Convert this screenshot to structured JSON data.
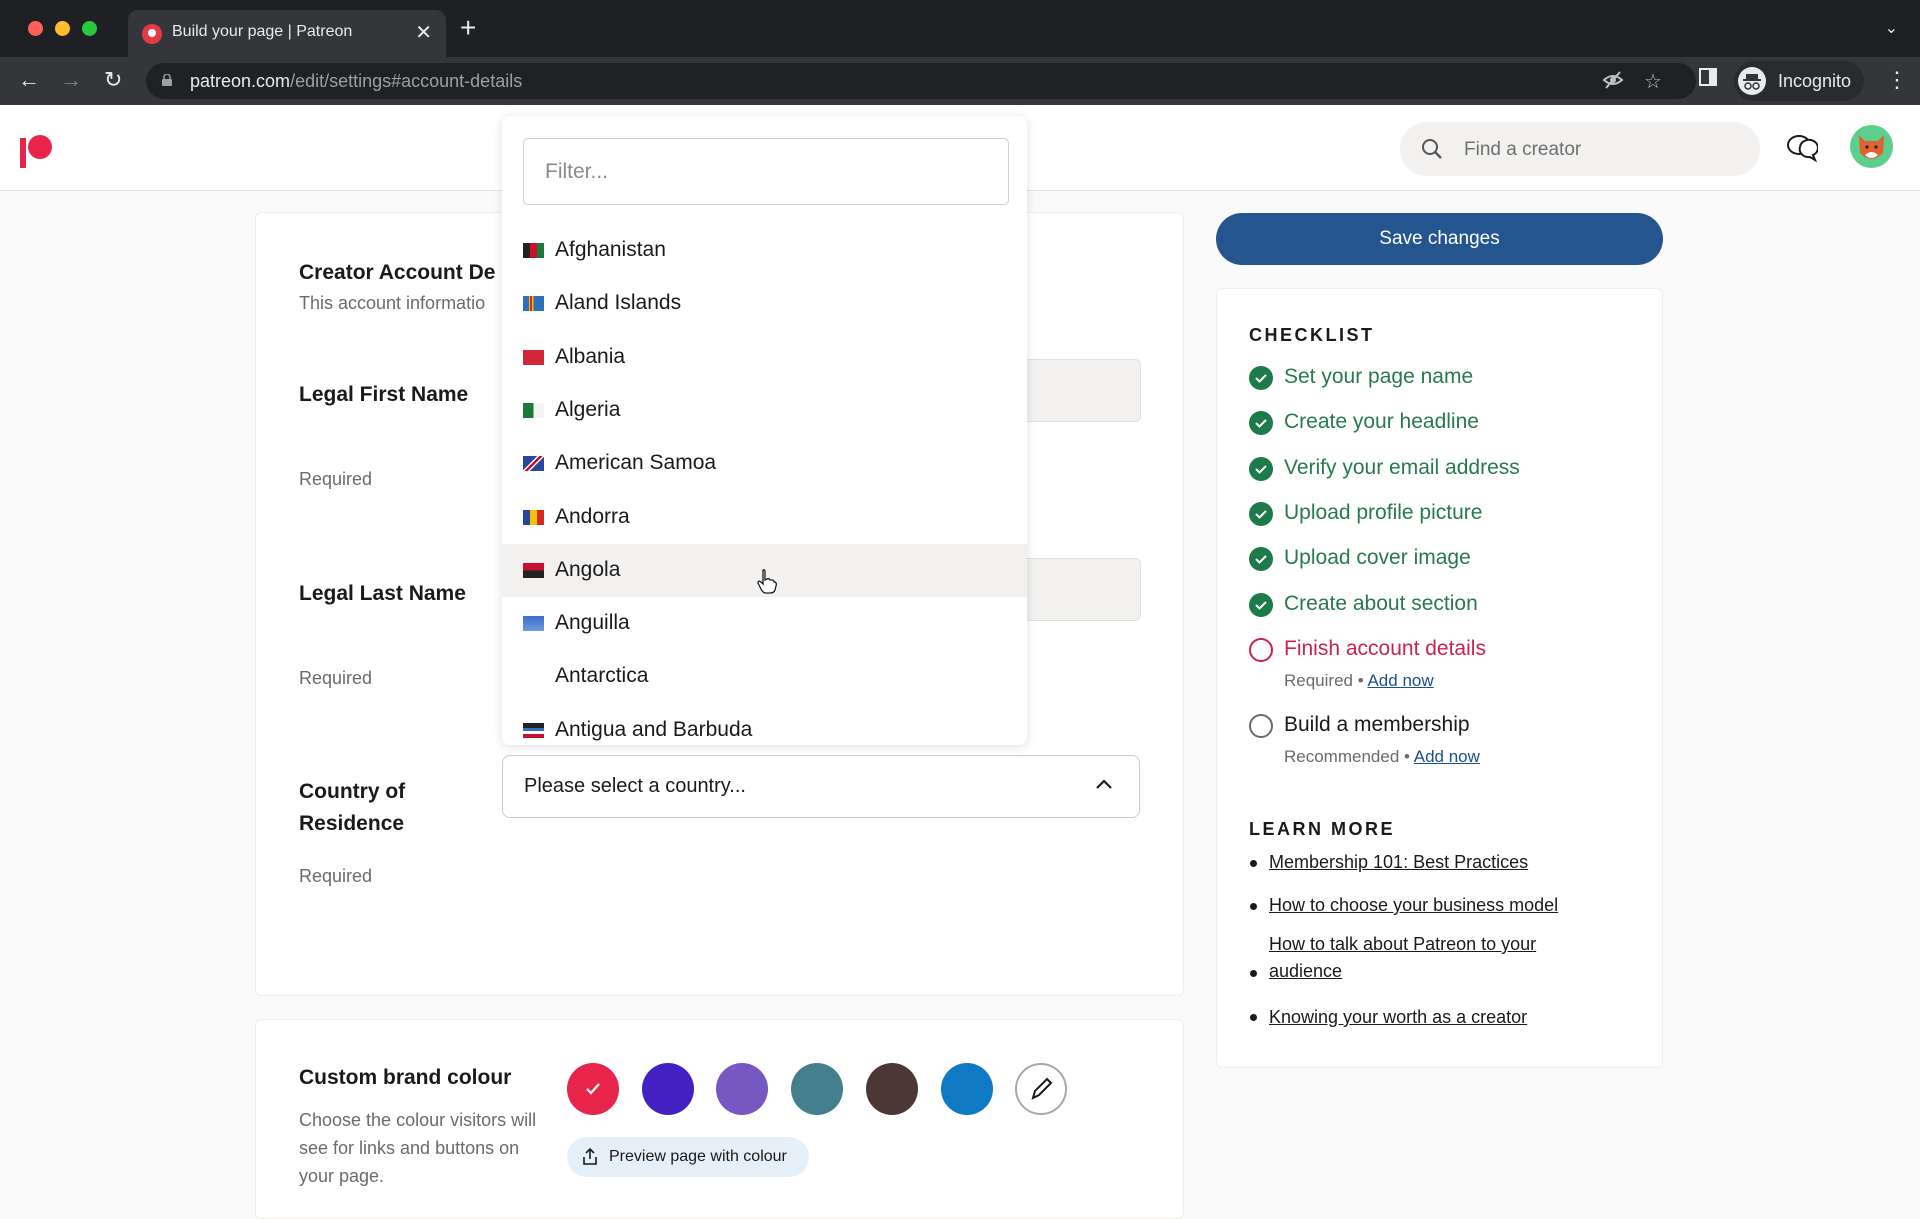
{
  "browser": {
    "tab_title": "Build your page | Patreon",
    "url_domain": "patreon.com",
    "url_path": "/edit/settings#account-details",
    "profile_label": "Incognito"
  },
  "header": {
    "search_placeholder": "Find a creator"
  },
  "account_details": {
    "title": "Creator Account De",
    "subtitle": "This account informatio",
    "fields": [
      {
        "label": "Legal First Name",
        "hint": "Required",
        "value": ""
      },
      {
        "label": "Legal Last Name",
        "hint": "Required",
        "value": ""
      },
      {
        "label": "Country of Residence",
        "hint": "Required",
        "value": "Please select a country..."
      }
    ]
  },
  "country_dropdown": {
    "filter_placeholder": "Filter...",
    "options": [
      {
        "name": "Afghanistan",
        "flag": "af"
      },
      {
        "name": "Aland Islands",
        "flag": "ax"
      },
      {
        "name": "Albania",
        "flag": "al"
      },
      {
        "name": "Algeria",
        "flag": "dz"
      },
      {
        "name": "American Samoa",
        "flag": "as"
      },
      {
        "name": "Andorra",
        "flag": "ad"
      },
      {
        "name": "Angola",
        "flag": "ao",
        "hovered": true
      },
      {
        "name": "Anguilla",
        "flag": "ai"
      },
      {
        "name": "Antarctica",
        "flag": ""
      },
      {
        "name": "Antigua and Barbuda",
        "flag": "ag"
      }
    ]
  },
  "brand_colour": {
    "title": "Custom brand colour",
    "description": "Choose the colour visitors will see for links and buttons on your page.",
    "swatches": [
      "#e8244b",
      "#4420c2",
      "#7757c2",
      "#437f8c",
      "#4b3734",
      "#0e7ac4"
    ],
    "selected_index": 0,
    "preview_label": "Preview page with colour"
  },
  "sidebar": {
    "save_label": "Save changes",
    "checklist_title": "CHECKLIST",
    "checklist": [
      {
        "label": "Set your page name",
        "status": "done"
      },
      {
        "label": "Create your headline",
        "status": "done"
      },
      {
        "label": "Verify your email address",
        "status": "done"
      },
      {
        "label": "Upload profile picture",
        "status": "done"
      },
      {
        "label": "Upload cover image",
        "status": "done"
      },
      {
        "label": "Create about section",
        "status": "done"
      },
      {
        "label": "Finish account details",
        "status": "required",
        "sub": "Required",
        "link": "Add now"
      },
      {
        "label": "Build a membership",
        "status": "recommended",
        "sub": "Recommended",
        "link": "Add now"
      }
    ],
    "learn_more_title": "LEARN MORE",
    "learn_more": [
      "Membership 101: Best Practices",
      "How to choose your business model",
      "How to talk about Patreon to your audience",
      "Knowing your worth as a creator"
    ]
  },
  "colors": {
    "brand": "#e8244b",
    "primary_button": "#24558f",
    "done_green": "#1d7a4a",
    "required_red": "#c8234b",
    "link_blue": "#1e508e"
  }
}
